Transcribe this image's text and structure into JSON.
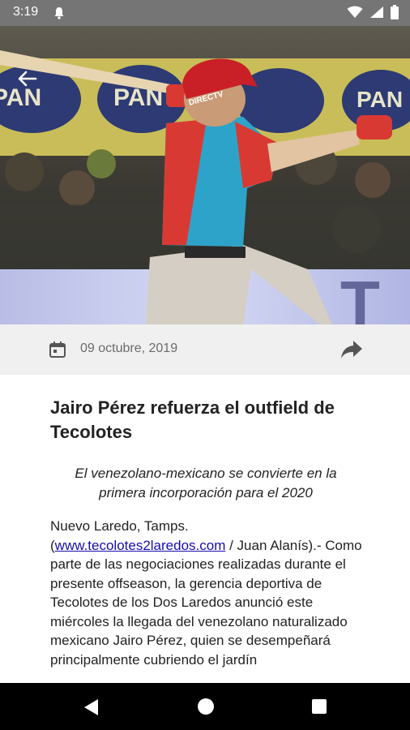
{
  "status_bar": {
    "time": "3:19",
    "icons": [
      "notification-bell-icon",
      "wifi-icon",
      "signal-icon",
      "battery-icon"
    ]
  },
  "hero": {
    "description_icon": "baseball-batter-photo",
    "back_icon": "arrow-back-icon",
    "jersey_text": "DIRECTV"
  },
  "meta": {
    "date": "09 octubre, 2019",
    "calendar_icon": "calendar-icon",
    "share_icon": "share-icon"
  },
  "article": {
    "title": "Jairo Pérez refuerza el outfield de Tecolotes",
    "subtitle": "El venezolano-mexicano se convierte en la primera incorporación para el 2020",
    "body_prefix": "Nuevo Laredo, Tamps. (",
    "body_link": "www.tecolotes2laredos.com",
    "body_suffix": " / Juan Alanís).- Como parte de las negociaciones realizadas durante el presente offseason, la gerencia deportiva de Tecolotes de los Dos Laredos anunció este miércoles la llegada del venezolano naturalizado mexicano Jairo Pérez, quien se desempeñará principalmente cubriendo el jardín"
  },
  "nav_bar": {
    "icons": [
      "nav-back-icon",
      "nav-home-icon",
      "nav-recents-icon"
    ]
  },
  "colors": {
    "status_bar": "#757575",
    "meta_bar": "#f0f0f0",
    "link": "#1a0dab",
    "jersey_blue": "#2ea3c9",
    "jersey_red": "#d83a33"
  }
}
